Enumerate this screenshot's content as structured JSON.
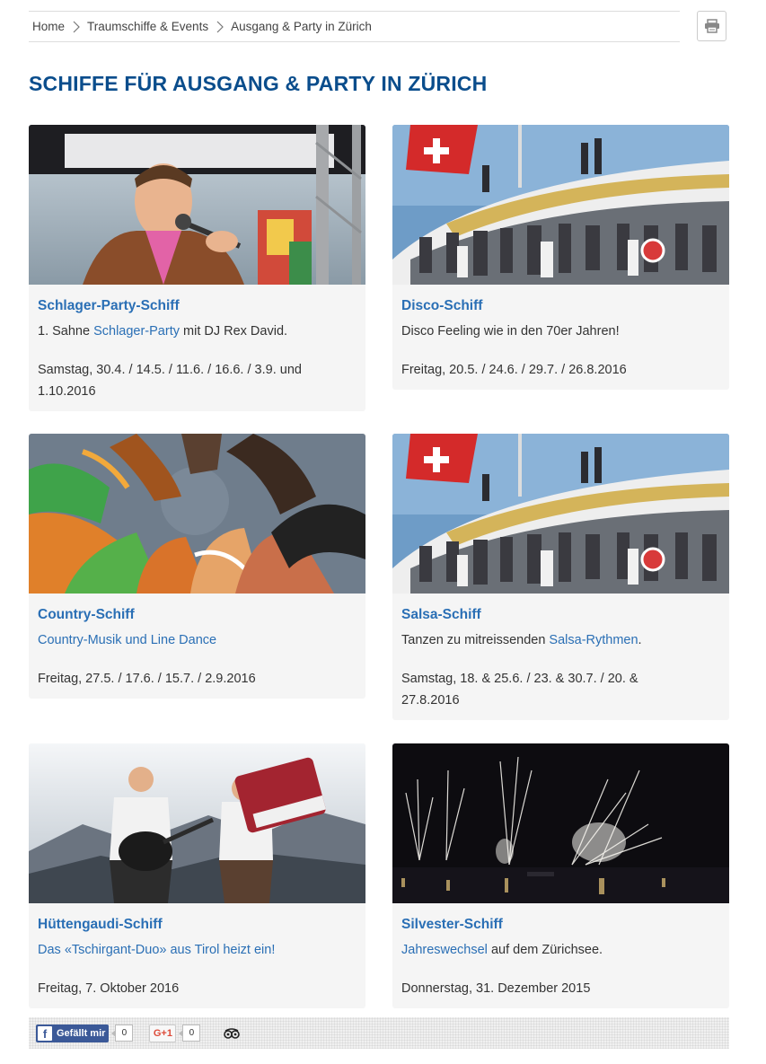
{
  "breadcrumb": [
    "Home",
    "Traumschiffe & Events",
    "Ausgang & Party in Zürich"
  ],
  "page_title": "SCHIFFE FÜR AUSGANG & PARTY IN ZÜRICH",
  "cards": [
    {
      "title": "Schlager-Party-Schiff",
      "desc_prefix": "1. Sahne ",
      "desc_link": "Schlager-Party",
      "desc_suffix": " mit DJ Rex David.",
      "date": "Samstag, 30.4. / 14.5. / 11.6. / 16.6. / 3.9. und 1.10.2016"
    },
    {
      "title": "Disco-Schiff",
      "desc_prefix": "Disco Feeling wie in den 70er Jahren!",
      "desc_link": "",
      "desc_suffix": "",
      "date": "Freitag, 20.5. / 24.6. / 29.7. / 26.8.2016"
    },
    {
      "title": "Country-Schiff",
      "desc_prefix": "",
      "desc_link": "Country-Musik und Line Dance",
      "desc_suffix": "",
      "date": "Freitag, 27.5. / 17.6. / 15.7. / 2.9.2016"
    },
    {
      "title": "Salsa-Schiff",
      "desc_prefix": "Tanzen zu mitreissenden ",
      "desc_link": "Salsa-Rythmen",
      "desc_suffix": ".",
      "date": "Samstag, 18. & 25.6. / 23. & 30.7. / 20. & 27.8.2016"
    },
    {
      "title": "Hüttengaudi-Schiff",
      "desc_prefix": "",
      "desc_link": "Das «Tschirgant-Duo» aus Tirol heizt ein!",
      "desc_suffix": "",
      "date": "Freitag, 7. Oktober 2016"
    },
    {
      "title": "Silvester-Schiff",
      "desc_prefix": "",
      "desc_link": "Jahreswechsel",
      "desc_suffix": " auf dem Zürichsee.",
      "date": "Donnerstag, 31. Dezember 2015"
    }
  ],
  "social": {
    "fb_label": "Gefällt mir",
    "fb_count": "0",
    "gplus_label": "G+1",
    "gplus_count": "0"
  },
  "icons": {
    "print": "printer-icon",
    "facebook": "facebook-icon",
    "tripadvisor": "tripadvisor-icon"
  },
  "colors": {
    "title": "#0a4d8c",
    "link": "#2a6fb5",
    "card_bg": "#f5f5f5",
    "facebook": "#3b5998",
    "gplus": "#dd4b39"
  }
}
